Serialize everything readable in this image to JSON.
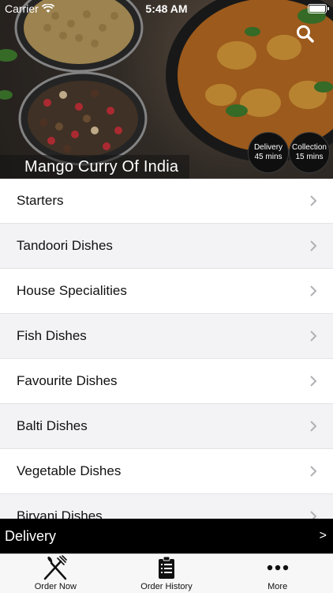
{
  "status_bar": {
    "carrier": "Carrier",
    "time": "5:48 AM",
    "battery_level": 1.0
  },
  "header": {
    "restaurant_name": "Mango Curry Of India",
    "delivery": {
      "label": "Delivery",
      "time": "45 mins"
    },
    "collection": {
      "label": "Collection",
      "time": "15 mins"
    },
    "search_icon": "search-icon"
  },
  "menu": {
    "categories": [
      {
        "label": "Starters"
      },
      {
        "label": "Tandoori Dishes"
      },
      {
        "label": "House Specialities"
      },
      {
        "label": "Fish Dishes"
      },
      {
        "label": "Favourite Dishes"
      },
      {
        "label": "Balti Dishes"
      },
      {
        "label": "Vegetable Dishes"
      },
      {
        "label": "Biryani Dishes"
      }
    ]
  },
  "cart_bar": {
    "label": "Delivery",
    "arrow": ">"
  },
  "tabs": [
    {
      "label": "Order Now",
      "icon": "fork-knife-icon"
    },
    {
      "label": "Order History",
      "icon": "clipboard-icon"
    },
    {
      "label": "More",
      "icon": "more-dots-icon"
    }
  ],
  "colors": {
    "accent": "#000000",
    "row_alt": "#f3f3f5"
  }
}
